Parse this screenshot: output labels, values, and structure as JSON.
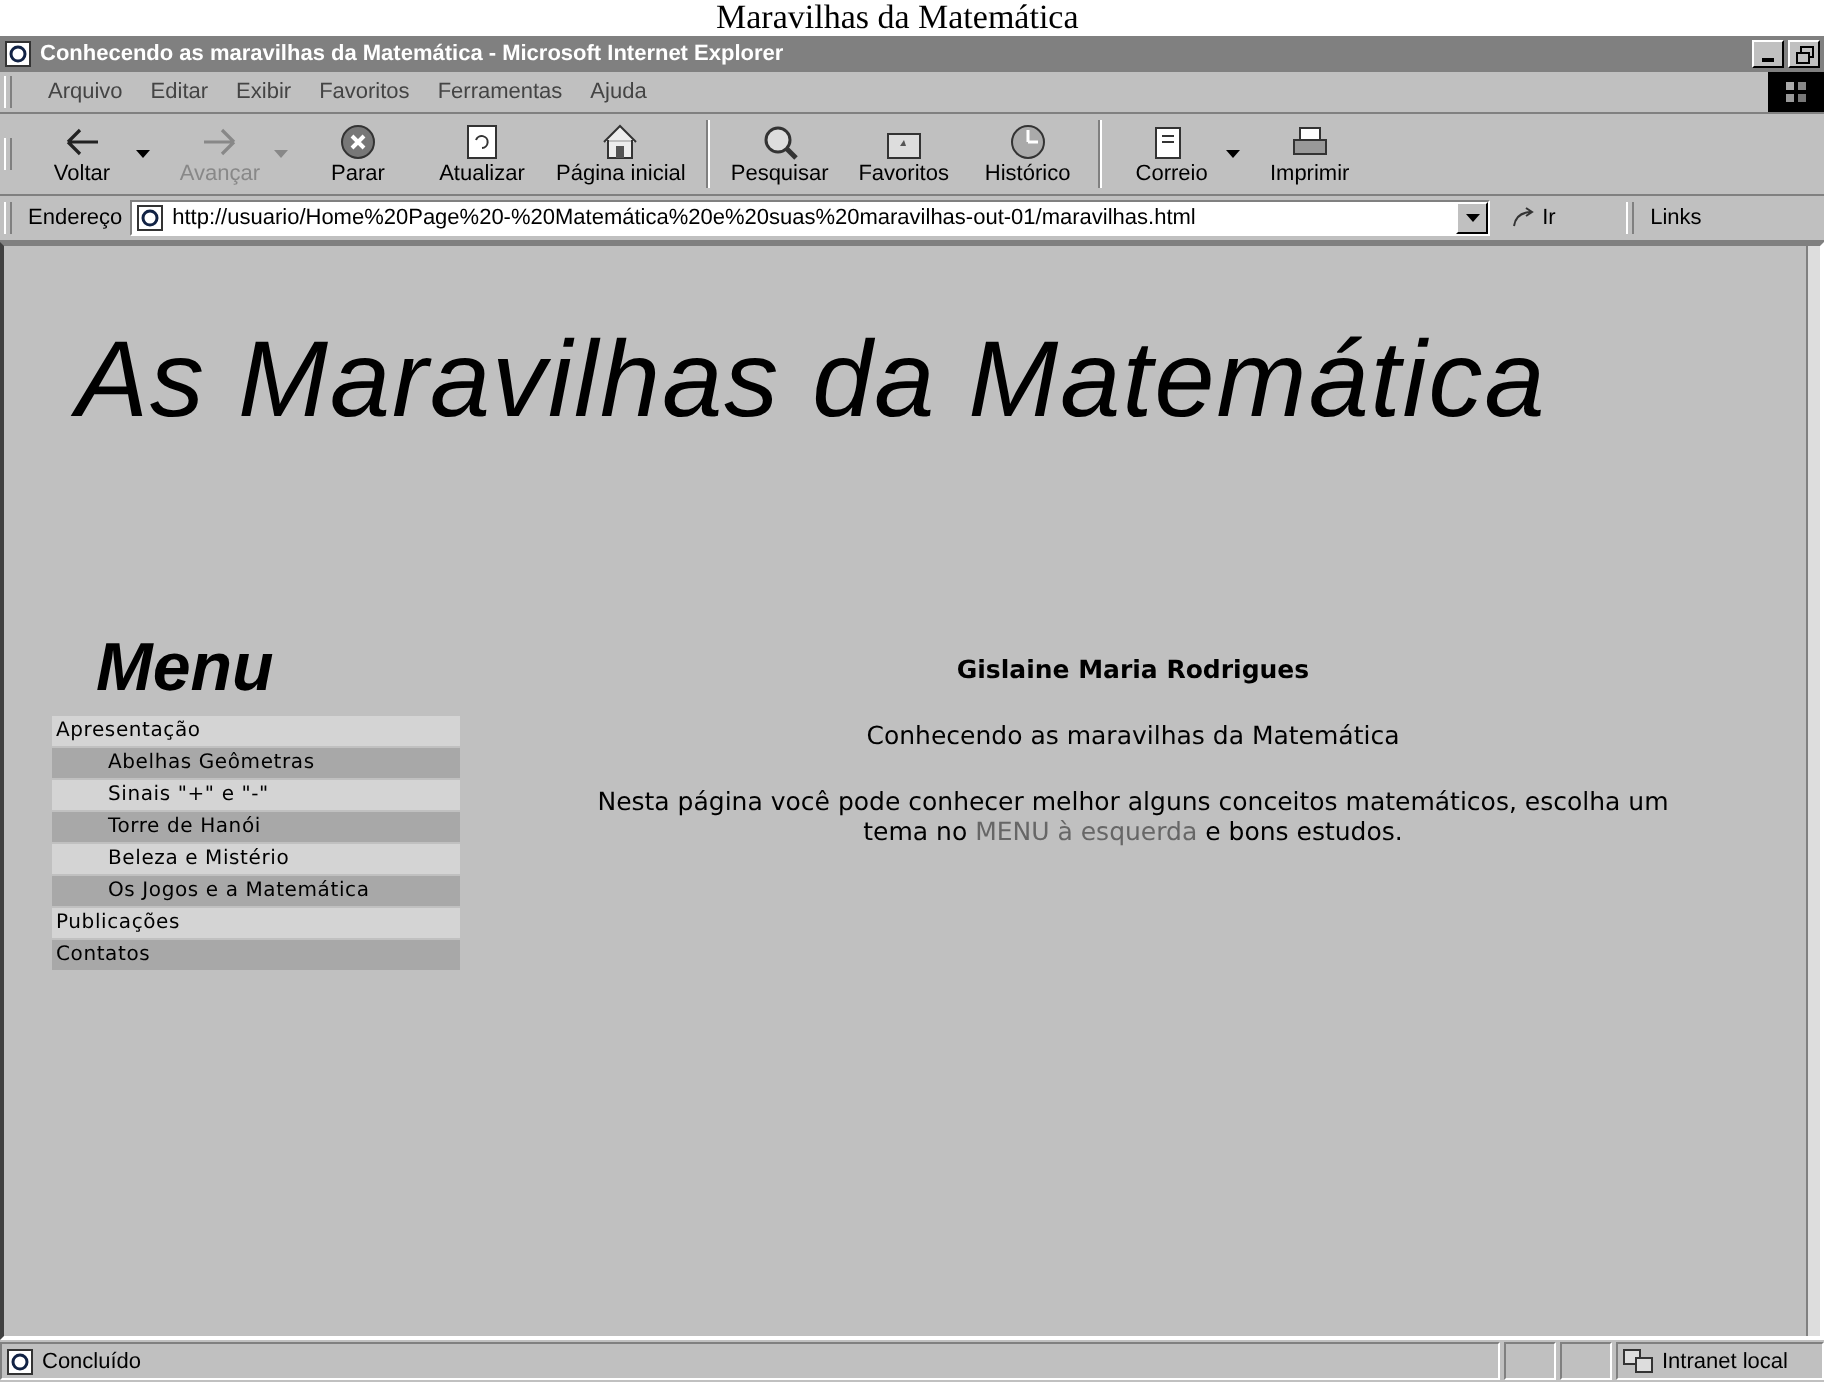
{
  "caption": "Maravilhas da Matemática",
  "window": {
    "title": "Conhecendo as maravilhas da Matemática - Microsoft Internet Explorer"
  },
  "menu_bar": [
    "Arquivo",
    "Editar",
    "Exibir",
    "Favoritos",
    "Ferramentas",
    "Ajuda"
  ],
  "toolbar": [
    {
      "label": "Voltar",
      "kind": "back",
      "disabled": false,
      "dropdown": true
    },
    {
      "label": "Avançar",
      "kind": "forward",
      "disabled": true,
      "dropdown": true
    },
    {
      "label": "Parar",
      "kind": "stop",
      "disabled": false,
      "dropdown": false
    },
    {
      "label": "Atualizar",
      "kind": "refresh",
      "disabled": false,
      "dropdown": false
    },
    {
      "label": "Página inicial",
      "kind": "home",
      "disabled": false,
      "dropdown": false
    },
    {
      "label": "Pesquisar",
      "kind": "search",
      "disabled": false,
      "dropdown": false
    },
    {
      "label": "Favoritos",
      "kind": "favorites",
      "disabled": false,
      "dropdown": false
    },
    {
      "label": "Histórico",
      "kind": "history",
      "disabled": false,
      "dropdown": false
    },
    {
      "label": "Correio",
      "kind": "mail",
      "disabled": false,
      "dropdown": true
    },
    {
      "label": "Imprimir",
      "kind": "print",
      "disabled": false,
      "dropdown": false
    }
  ],
  "address_bar": {
    "label": "Endereço",
    "value": "http://usuario/Home%20Page%20-%20Matemática%20e%20suas%20maravilhas-out-01/maravilhas.html",
    "go": "Ir",
    "links": "Links"
  },
  "page": {
    "heading": "As Maravilhas da Matemática",
    "menu_title": "Menu",
    "menu": [
      {
        "label": "Apresentação",
        "children": [
          {
            "label": "Abelhas Geômetras"
          },
          {
            "label": "Sinais \"+\" e \"-\""
          },
          {
            "label": "Torre de Hanói"
          },
          {
            "label": "Beleza e Mistério"
          },
          {
            "label": "Os Jogos e a Matemática"
          }
        ]
      },
      {
        "label": "Publicações"
      },
      {
        "label": "Contatos"
      }
    ],
    "author": "Gislaine Maria Rodrigues",
    "subtitle": "Conhecendo as maravilhas da Matemática",
    "intro_before": "Nesta página você pode conhecer melhor alguns conceitos matemáticos, escolha um tema no",
    "intro_link": "MENU à esquerda",
    "intro_after": "e bons estudos."
  },
  "status_bar": {
    "text": "Concluído",
    "zone": "Intranet local"
  }
}
